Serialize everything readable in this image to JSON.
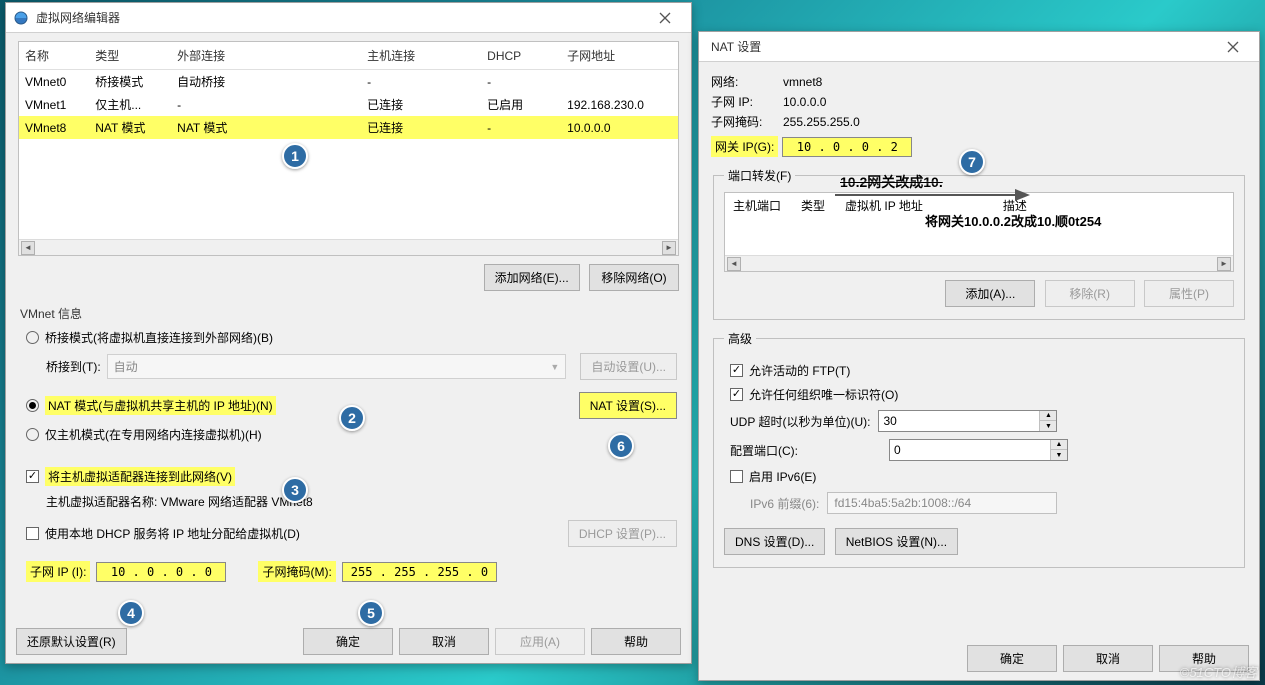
{
  "win1": {
    "title": "虚拟网络编辑器",
    "table": {
      "headers": [
        "名称",
        "类型",
        "外部连接",
        "主机连接",
        "DHCP",
        "子网地址"
      ],
      "rows": [
        {
          "name": "VMnet0",
          "type": "桥接模式",
          "ext": "自动桥接",
          "host": "-",
          "dhcp": "-",
          "subnet": ""
        },
        {
          "name": "VMnet1",
          "type": "仅主机...",
          "ext": "-",
          "host": "已连接",
          "dhcp": "已启用",
          "subnet": "192.168.230.0"
        },
        {
          "name": "VMnet8",
          "type": "NAT 模式",
          "ext": "NAT 模式",
          "host": "已连接",
          "dhcp": "-",
          "subnet": "10.0.0.0"
        }
      ]
    },
    "add_net": "添加网络(E)...",
    "remove_net": "移除网络(O)",
    "vmnet_info_label": "VMnet 信息",
    "bridge_opt": "桥接模式(将虚拟机直接连接到外部网络)(B)",
    "bridge_to_label": "桥接到(T):",
    "bridge_to_value": "自动",
    "auto_set": "自动设置(U)...",
    "nat_opt": "NAT 模式(与虚拟机共享主机的 IP 地址)(N)",
    "nat_settings": "NAT 设置(S)...",
    "hostonly_opt": "仅主机模式(在专用网络内连接虚拟机)(H)",
    "connect_host": "将主机虚拟适配器连接到此网络(V)",
    "host_adapter_label": "主机虚拟适配器名称: VMware 网络适配器 VMnet8",
    "use_dhcp": "使用本地 DHCP 服务将 IP 地址分配给虚拟机(D)",
    "dhcp_settings": "DHCP 设置(P)...",
    "subnet_ip_label": "子网 IP (I):",
    "subnet_ip_value": "10 . 0 . 0 . 0",
    "subnet_mask_label": "子网掩码(M):",
    "subnet_mask_value": "255 . 255 . 255 . 0",
    "restore": "还原默认设置(R)",
    "ok": "确定",
    "cancel": "取消",
    "apply": "应用(A)",
    "help": "帮助"
  },
  "win2": {
    "title": "NAT 设置",
    "network_label": "网络:",
    "network_value": "vmnet8",
    "subnetip_label": "子网 IP:",
    "subnetip_value": "10.0.0.0",
    "mask_label": "子网掩码:",
    "mask_value": "255.255.255.0",
    "gateway_label": "网关 IP(G):",
    "gateway_value": "10 . 0 . 0 . 2",
    "pf_legend": "端口转发(F)",
    "pf_cols": [
      "主机端口",
      "类型",
      "虚拟机 IP 地址",
      "描述"
    ],
    "add": "添加(A)...",
    "remove": "移除(R)",
    "props": "属性(P)",
    "adv_legend": "高级",
    "allow_ftp": "允许活动的 FTP(T)",
    "allow_org": "允许任何组织唯一标识符(O)",
    "udp_label": "UDP 超时(以秒为单位)(U):",
    "udp_value": "30",
    "cfg_port_label": "配置端口(C):",
    "cfg_port_value": "0",
    "ipv6_enable": "启用 IPv6(E)",
    "ipv6_prefix_label": "IPv6 前缀(6):",
    "ipv6_prefix_value": "fd15:4ba5:5a2b:1008::/64",
    "dns_btn": "DNS 设置(D)...",
    "netbios_btn": "NetBIOS 设置(N)...",
    "ok": "确定",
    "cancel": "取消",
    "help": "帮助"
  },
  "annotation": {
    "strike": "10.2网关改成10.",
    "inside": "将网关10.0.0.2改成10.顺0t254"
  },
  "watermark": "©51CTO博客"
}
